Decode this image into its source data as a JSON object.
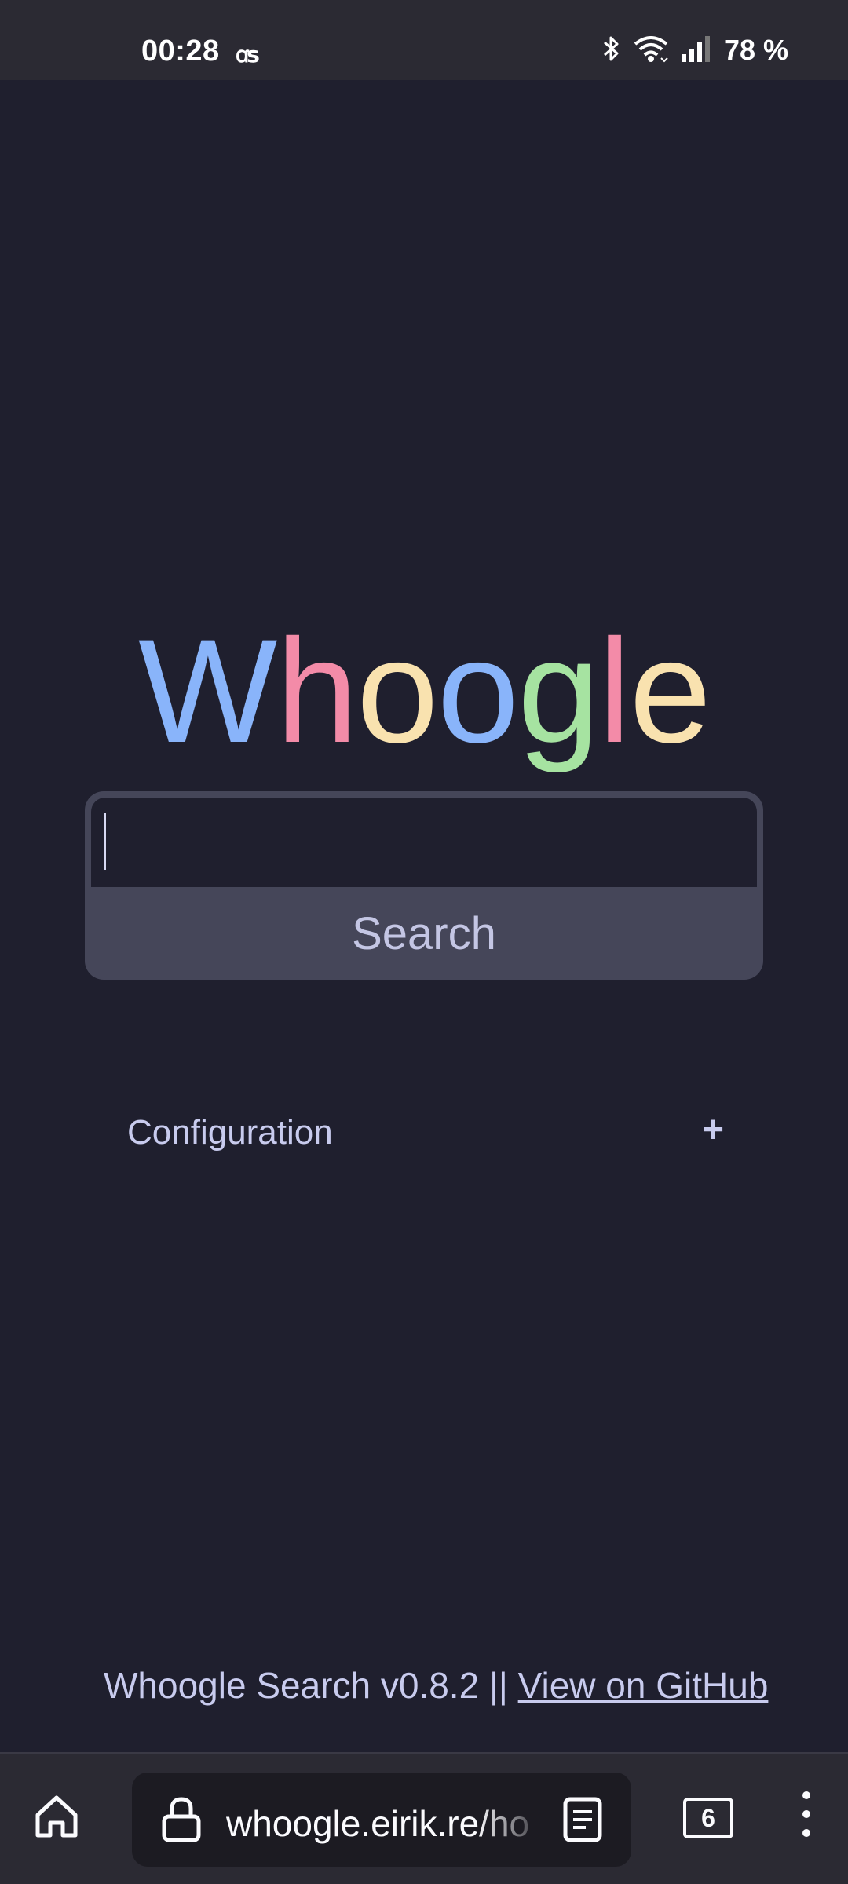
{
  "status_bar": {
    "time": "00:28",
    "app_indicator": "ꭤꜱ",
    "battery": "78 %"
  },
  "logo": {
    "letters": [
      "W",
      "h",
      "o",
      "o",
      "g",
      "l",
      "e"
    ],
    "colors": [
      "#89b4fa",
      "#f38ba8",
      "#f9e2af",
      "#89b4fa",
      "#a6e3a1",
      "#f38ba8",
      "#f9e2af"
    ]
  },
  "search": {
    "input_value": "",
    "button_label": "Search"
  },
  "config": {
    "label": "Configuration",
    "toggle": "+"
  },
  "footer": {
    "text": "Whoogle Search v0.8.2 || ",
    "link": "View on GitHub"
  },
  "browser": {
    "url": "whoogle.eirik.re/home",
    "tab_count": "6"
  },
  "colors": {
    "background": "#1f1f2e",
    "search_frame": "#454659",
    "text": "#c8cbee"
  },
  "icons": [
    "bluetooth-icon",
    "wifi-icon",
    "signal-icon",
    "home-icon",
    "lock-icon",
    "reader-view-icon",
    "tabs-icon",
    "menu-icon"
  ]
}
